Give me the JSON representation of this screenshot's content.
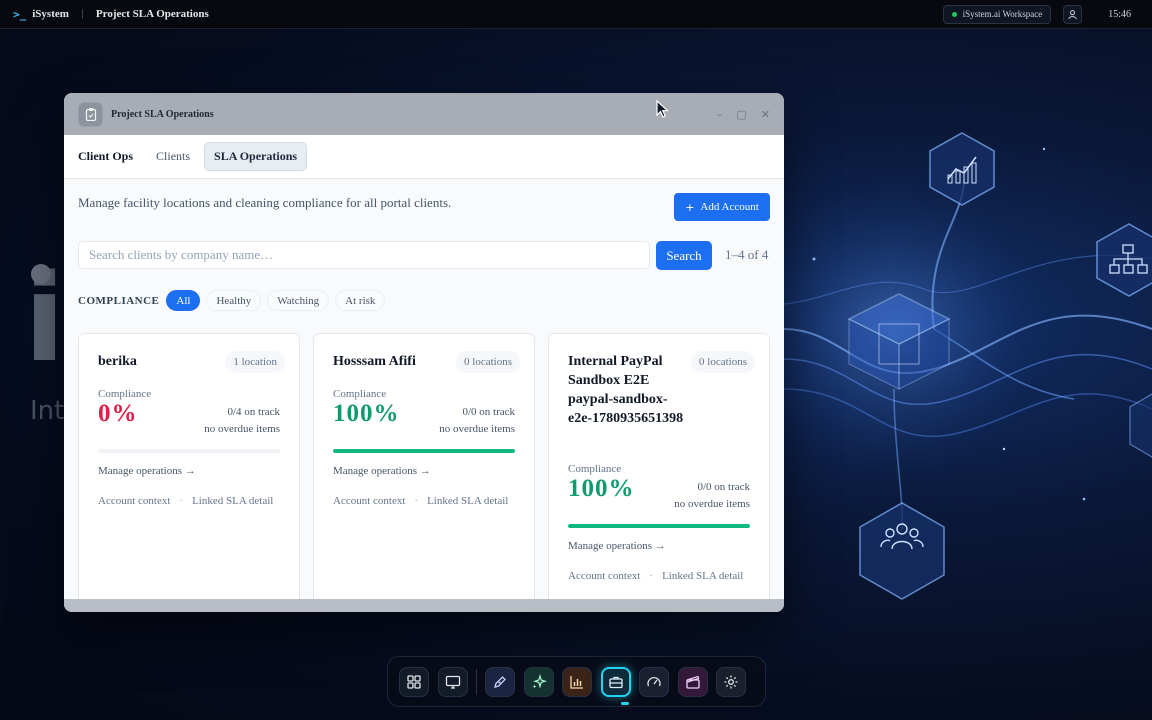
{
  "topbar": {
    "app_name": "iSystem",
    "page_title": "Project SLA Operations",
    "workspace": "iSystem.ai Workspace",
    "time": "15:46"
  },
  "background": {
    "letter": "i",
    "partial_text": "Int"
  },
  "window": {
    "title": "Project SLA Operations",
    "controls": {
      "minimize": "–",
      "maximize": "▢",
      "close": "✕"
    }
  },
  "nav": {
    "brand": "Client Ops",
    "tabs": [
      {
        "label": "Clients",
        "active": false
      },
      {
        "label": "SLA Operations",
        "active": true
      }
    ]
  },
  "page": {
    "description": "Manage facility locations and cleaning compliance for all portal clients.",
    "add_button": "Add Account",
    "search_placeholder": "Search clients by company name…",
    "search_button": "Search",
    "result_count": "1–4 of 4"
  },
  "filters": {
    "label": "COMPLIANCE",
    "options": [
      "All",
      "Healthy",
      "Watching",
      "At risk"
    ],
    "selected": "All"
  },
  "cards": [
    {
      "name": "berika",
      "locations": "1 location",
      "compliance_label": "Compliance",
      "percent": "0%",
      "on_track": "0/4 on track",
      "overdue": "no overdue items",
      "progress": 0,
      "manage": "Manage operations →",
      "link1": "Account context",
      "link2": "Linked SLA detail"
    },
    {
      "name": "Hosssam Afifi",
      "locations": "0 locations",
      "compliance_label": "Compliance",
      "percent": "100%",
      "on_track": "0/0 on track",
      "overdue": "no overdue items",
      "progress": 1,
      "manage": "Manage operations →",
      "link1": "Account context",
      "link2": "Linked SLA detail"
    },
    {
      "name": "Internal PayPal Sandbox E2E paypal-sandbox-e2e-1780935651398",
      "locations": "0 locations",
      "compliance_label": "Compliance",
      "percent": "100%",
      "on_track": "0/0 on track",
      "overdue": "no overdue items",
      "progress": 1,
      "manage": "Manage operations →",
      "link1": "Account context",
      "link2": "Linked SLA detail"
    }
  ],
  "dock": {
    "icons": [
      "grid-icon",
      "monitor-icon",
      "pen-icon",
      "sparkles-icon",
      "bar-chart-icon",
      "briefcase-icon",
      "gauge-icon",
      "clapperboard-icon",
      "gear-icon"
    ],
    "active": "briefcase-icon"
  },
  "colors": {
    "accent": "#1d6ff2",
    "success": "#10b981",
    "danger": "#e11d48"
  }
}
